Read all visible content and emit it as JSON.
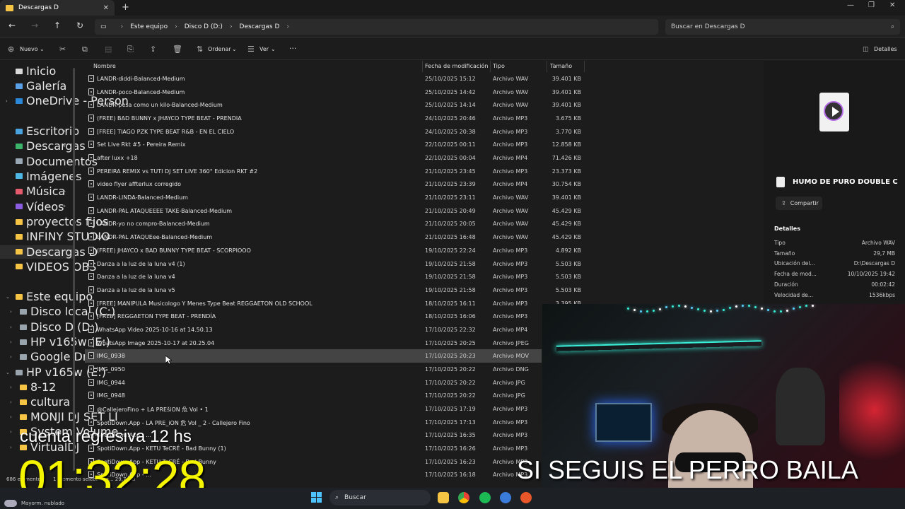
{
  "tab": {
    "title": "Descargas D"
  },
  "breadcrumb": [
    "Este equipo",
    "Disco D (D:)",
    "Descargas D"
  ],
  "search": {
    "placeholder": "Buscar en Descargas D"
  },
  "toolbar": {
    "new": "Nuevo",
    "sort": "Ordenar",
    "view": "Ver",
    "more": "···",
    "details": "Detalles"
  },
  "sidebar": {
    "quick": [
      {
        "label": "Inicio"
      },
      {
        "label": "Galería"
      },
      {
        "label": "OneDrive - Person"
      }
    ],
    "pinned": [
      {
        "label": "Escritorio"
      },
      {
        "label": "Descargas"
      },
      {
        "label": "Documentos"
      },
      {
        "label": "Imágenes"
      },
      {
        "label": "Música"
      },
      {
        "label": "Vídeos"
      }
    ],
    "folders": [
      {
        "label": "proyectos fijos"
      },
      {
        "label": "INFINY STUDIO"
      },
      {
        "label": "Descargas D"
      },
      {
        "label": "VIDEOS OBS"
      }
    ],
    "pc": [
      {
        "label": "Este equipo"
      },
      {
        "label": "Disco local (C:)"
      },
      {
        "label": "Disco D (D:)"
      },
      {
        "label": "HP v165w (E:)"
      },
      {
        "label": "Google Drive (G"
      },
      {
        "label": "HP v165w (E:)"
      },
      {
        "label": "8-12"
      },
      {
        "label": "cultura"
      },
      {
        "label": "MONJI DJ SET LI"
      },
      {
        "label": "System Volume"
      },
      {
        "label": "VirtualDJ"
      }
    ]
  },
  "columns": {
    "name": "Nombre",
    "date": "Fecha de modificación",
    "type": "Tipo",
    "size": "Tamaño"
  },
  "files": [
    {
      "name": "LANDR-diddi-Balanced-Medium",
      "date": "25/10/2025 15:12",
      "type": "Archivo WAV",
      "size": "39.401 KB"
    },
    {
      "name": "LANDR-poco-Balanced-Medium",
      "date": "25/10/2025 14:42",
      "type": "Archivo WAV",
      "size": "39.401 KB"
    },
    {
      "name": "LANDR-pesa como un kilo-Balanced-Medium",
      "date": "25/10/2025 14:14",
      "type": "Archivo WAV",
      "size": "39.401 KB"
    },
    {
      "name": "(FREE) BAD BUNNY x JHAYCO TYPE BEAT - PRENDIA",
      "date": "24/10/2025 20:46",
      "type": "Archivo MP3",
      "size": "3.675 KB"
    },
    {
      "name": "[FREE] TIAGO PZK TYPE BEAT R&B - EN EL CIELO",
      "date": "24/10/2025 20:38",
      "type": "Archivo MP3",
      "size": "3.770 KB"
    },
    {
      "name": "Set Live Rkt #5 - Pereira Remix",
      "date": "22/10/2025 00:11",
      "type": "Archivo MP3",
      "size": "12.858 KB"
    },
    {
      "name": "after luxx +18",
      "date": "22/10/2025 00:04",
      "type": "Archivo MP4",
      "size": "71.426 KB"
    },
    {
      "name": "PEREIRA REMIX vs TUTI DJ  SET LIVE 360°  Edicion RKT #2",
      "date": "21/10/2025 23:45",
      "type": "Archivo MP3",
      "size": "23.373 KB"
    },
    {
      "name": "video flyer affterlux corregido",
      "date": "21/10/2025 23:39",
      "type": "Archivo MP4",
      "size": "30.754 KB"
    },
    {
      "name": "LANDR-LINDA-Balanced-Medium",
      "date": "21/10/2025 23:11",
      "type": "Archivo WAV",
      "size": "39.401 KB"
    },
    {
      "name": "LANDR-PAL ATAQUEEEE TAKE-Balanced-Medium",
      "date": "21/10/2025 20:49",
      "type": "Archivo WAV",
      "size": "45.429 KB"
    },
    {
      "name": "LANDR-yo no compro-Balanced-Medium",
      "date": "21/10/2025 20:05",
      "type": "Archivo WAV",
      "size": "45.429 KB"
    },
    {
      "name": "LANDR-PAL ATAQUEee-Balanced-Medium",
      "date": "21/10/2025 16:48",
      "type": "Archivo WAV",
      "size": "45.429 KB"
    },
    {
      "name": "(FREE) JHAYCO x BAD BUNNY TYPE BEAT - SCORPIOOO",
      "date": "19/10/2025 22:24",
      "type": "Archivo MP3",
      "size": "4.892 KB"
    },
    {
      "name": "Danza a la luz de la luna v4 (1)",
      "date": "19/10/2025 21:58",
      "type": "Archivo MP3",
      "size": "5.503 KB"
    },
    {
      "name": "Danza a la luz de la luna v4",
      "date": "19/10/2025 21:58",
      "type": "Archivo MP3",
      "size": "5.503 KB"
    },
    {
      "name": "Danza a la luz de la luna v5",
      "date": "19/10/2025 21:58",
      "type": "Archivo MP3",
      "size": "5.503 KB"
    },
    {
      "name": "[FREE] MANIPULA  Musicologo Y Menes Type Beat REGGAETON OLD SCHOOL",
      "date": "18/10/2025 16:11",
      "type": "Archivo MP3",
      "size": "3.395 KB"
    },
    {
      "name": "[FREE] REGGAETON TYPE BEAT - PRENDÍA",
      "date": "18/10/2025 16:06",
      "type": "Archivo MP3",
      "size": ""
    },
    {
      "name": "WhatsApp Video 2025-10-16 at 14.50.13",
      "date": "17/10/2025 22:32",
      "type": "Archivo MP4",
      "size": ""
    },
    {
      "name": "WhatsApp Image 2025-10-17 at 20.25.04",
      "date": "17/10/2025 20:25",
      "type": "Archivo JPEG",
      "size": ""
    },
    {
      "name": "IMG_0938",
      "date": "17/10/2025 20:23",
      "type": "Archivo MOV",
      "size": ""
    },
    {
      "name": "IMG_0950",
      "date": "17/10/2025 20:22",
      "type": "Archivo DNG",
      "size": ""
    },
    {
      "name": "IMG_0944",
      "date": "17/10/2025 20:22",
      "type": "Archivo JPG",
      "size": ""
    },
    {
      "name": "IMG_0948",
      "date": "17/10/2025 20:22",
      "type": "Archivo JPG",
      "size": ""
    },
    {
      "name": "@CallejeroFino  + LA PREšiON 危 Vol • 1",
      "date": "17/10/2025 17:19",
      "type": "Archivo MP3",
      "size": ""
    },
    {
      "name": "SpotiDown.App - LA PRE_iON 危 Vol _ 2 - Callejero Fino",
      "date": "17/10/2025 17:13",
      "type": "Archivo MP3",
      "size": ""
    },
    {
      "name": "SpotiDown.App - ...",
      "date": "17/10/2025 16:35",
      "type": "Archivo MP3",
      "size": ""
    },
    {
      "name": "SpotiDown.App - KETU TeCRÉ - Bad Bunny (1)",
      "date": "17/10/2025 16:26",
      "type": "Archivo MP3",
      "size": ""
    },
    {
      "name": "SpotiDown.App - KETU TeCRÉ - Bad Bunny",
      "date": "17/10/2025 16:23",
      "type": "Archivo MP3",
      "size": ""
    },
    {
      "name": "SpotiDown.App - ...",
      "date": "17/10/2025 16:18",
      "type": "Archivo MP3",
      "size": ""
    }
  ],
  "selected_index": 21,
  "details": {
    "filename": "HUMO DE PURO DOUBLE C",
    "share": "Compartir",
    "section": "Detalles",
    "rows": [
      {
        "k": "Tipo",
        "v": "Archivo WAV"
      },
      {
        "k": "Tamaño",
        "v": "29,7 MB"
      },
      {
        "k": "Ubicación del...",
        "v": "D:\\Descargas D"
      },
      {
        "k": "Fecha de mod...",
        "v": "10/10/2025 19:42"
      },
      {
        "k": "Duración",
        "v": "00:02:42"
      },
      {
        "k": "Velocidad de...",
        "v": "1536kbps"
      }
    ]
  },
  "status": {
    "count": "686 elementos",
    "selected": "1 elemento selecciona... 29,7 MB"
  },
  "overlay": {
    "countdown_label": "cuenta regresiva 12 hs",
    "timer": "01:32:28",
    "caption": "SI SEGUIS EL PERRO BAILA"
  },
  "taskbar": {
    "search": "Buscar",
    "weather": "Mayorm. nublado"
  },
  "colors": {
    "accent": "#0067c0",
    "folder": "#f5c445",
    "timer": "#f5f500"
  }
}
